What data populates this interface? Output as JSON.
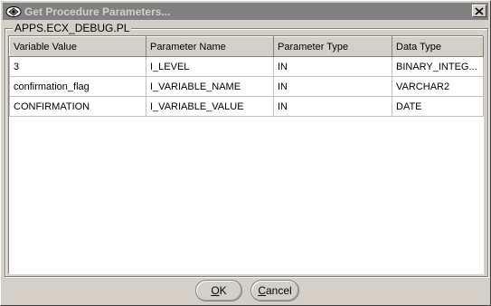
{
  "window": {
    "title": "Get Procedure Parameters...",
    "icon": "oracle-forms-icon",
    "close_icon": "close-icon"
  },
  "group": {
    "label": "APPS.ECX_DEBUG.PL"
  },
  "table": {
    "columns": [
      "Variable Value",
      "Parameter Name",
      "Parameter Type",
      "Data Type"
    ],
    "rows": [
      [
        "3",
        "I_LEVEL",
        "IN",
        "BINARY_INTEG..."
      ],
      [
        "confirmation_flag",
        "I_VARIABLE_NAME",
        "IN",
        "VARCHAR2"
      ],
      [
        "CONFIRMATION",
        "I_VARIABLE_VALUE",
        "IN",
        "DATE"
      ]
    ]
  },
  "buttons": {
    "ok": {
      "mnemonic": "O",
      "rest": "K"
    },
    "cancel": {
      "mnemonic": "C",
      "rest": "ancel"
    }
  }
}
